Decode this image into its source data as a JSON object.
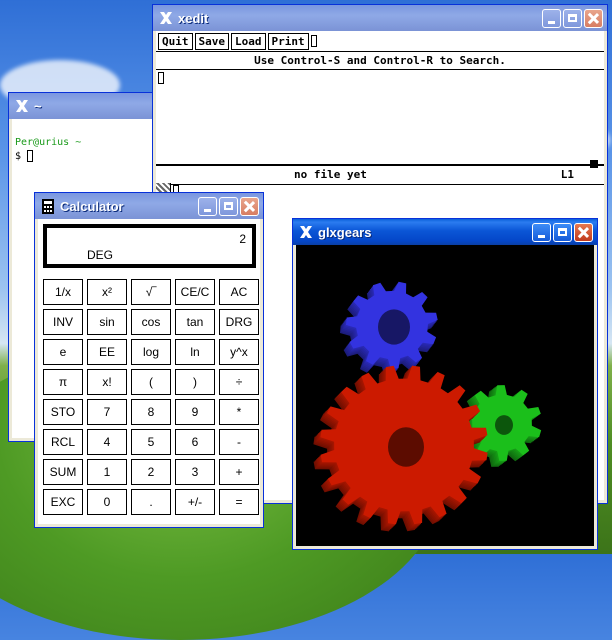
{
  "terminal": {
    "title": "~",
    "prompt_user": "Per@urius ~",
    "prompt_symbol": "$"
  },
  "xedit": {
    "title": "xedit",
    "menu": [
      "Quit",
      "Save",
      "Load",
      "Print"
    ],
    "message": "Use Control-S and Control-R to Search.",
    "file_status": "no file yet",
    "line_indicator": "L1"
  },
  "calculator": {
    "title": "Calculator",
    "display_value": "2",
    "display_mode": "DEG",
    "keys": [
      [
        "1/x",
        "x²",
        "√‾",
        "CE/C",
        "AC"
      ],
      [
        "INV",
        "sin",
        "cos",
        "tan",
        "DRG"
      ],
      [
        "e",
        "EE",
        "log",
        "ln",
        "y^x"
      ],
      [
        "π",
        "x!",
        "(",
        ")",
        "÷"
      ],
      [
        "STO",
        "7",
        "8",
        "9",
        "*"
      ],
      [
        "RCL",
        "4",
        "5",
        "6",
        "-"
      ],
      [
        "SUM",
        "1",
        "2",
        "3",
        "+"
      ],
      [
        "EXC",
        "0",
        ".",
        "+/-",
        "="
      ]
    ]
  },
  "glxgears": {
    "title": "glxgears",
    "colors": {
      "red": "#cc1a00",
      "green": "#1bbf1b",
      "blue": "#3333e0"
    }
  }
}
